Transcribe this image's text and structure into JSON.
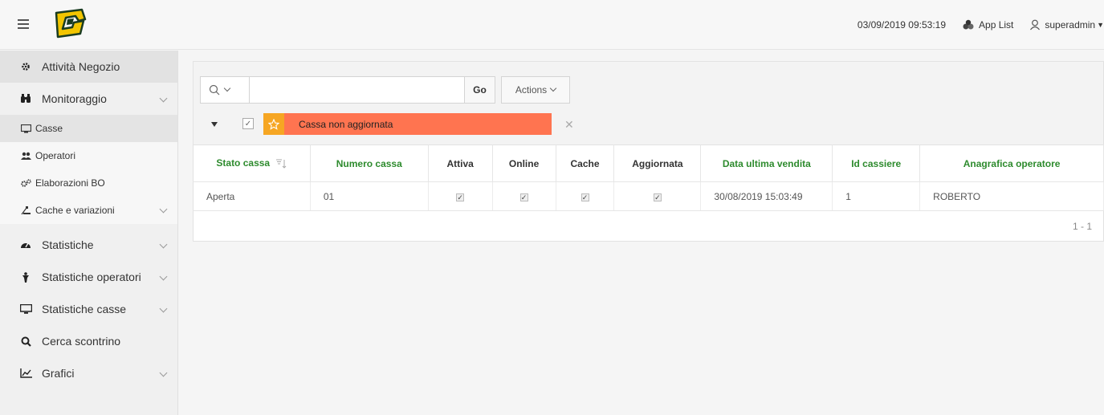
{
  "header": {
    "datetime": "03/09/2019 09:53:19",
    "app_list": "App List",
    "user": "superadmin"
  },
  "sidebar": {
    "items": [
      {
        "label": "Attività Negozio",
        "icon": "gear-icon"
      },
      {
        "label": "Monitoraggio",
        "icon": "binoculars-icon"
      },
      {
        "label": "Casse",
        "icon": "monitor-icon"
      },
      {
        "label": "Operatori",
        "icon": "users-icon"
      },
      {
        "label": "Elaborazioni BO",
        "icon": "gears-icon"
      },
      {
        "label": "Cache e variazioni",
        "icon": "cache-icon"
      },
      {
        "label": "Statistiche",
        "icon": "dashboard-icon"
      },
      {
        "label": "Statistiche operatori",
        "icon": "operator-icon"
      },
      {
        "label": "Statistiche casse",
        "icon": "monitor-icon"
      },
      {
        "label": "Cerca scontrino",
        "icon": "search-icon"
      },
      {
        "label": "Grafici",
        "icon": "line-chart-icon"
      }
    ]
  },
  "toolbar": {
    "search_value": "",
    "go_label": "Go",
    "actions_label": "Actions"
  },
  "filter": {
    "label": "Cassa non aggiornata",
    "color": "#ff7450"
  },
  "table": {
    "columns": [
      "Stato cassa",
      "Numero cassa",
      "Attiva",
      "Online",
      "Cache",
      "Aggiornata",
      "Data ultima vendita",
      "Id cassiere",
      "Anagrafica operatore"
    ],
    "rows": [
      {
        "stato": "Aperta",
        "numero": "01",
        "attiva": true,
        "online": true,
        "cache": true,
        "aggiornata": true,
        "data": "30/08/2019 15:03:49",
        "id_cassiere": "1",
        "operatore": "ROBERTO"
      }
    ],
    "pagination": "1 - 1"
  },
  "colors": {
    "accent_green": "#2e8b2e",
    "star": "#f6a623",
    "filter_bg": "#ff7450"
  }
}
